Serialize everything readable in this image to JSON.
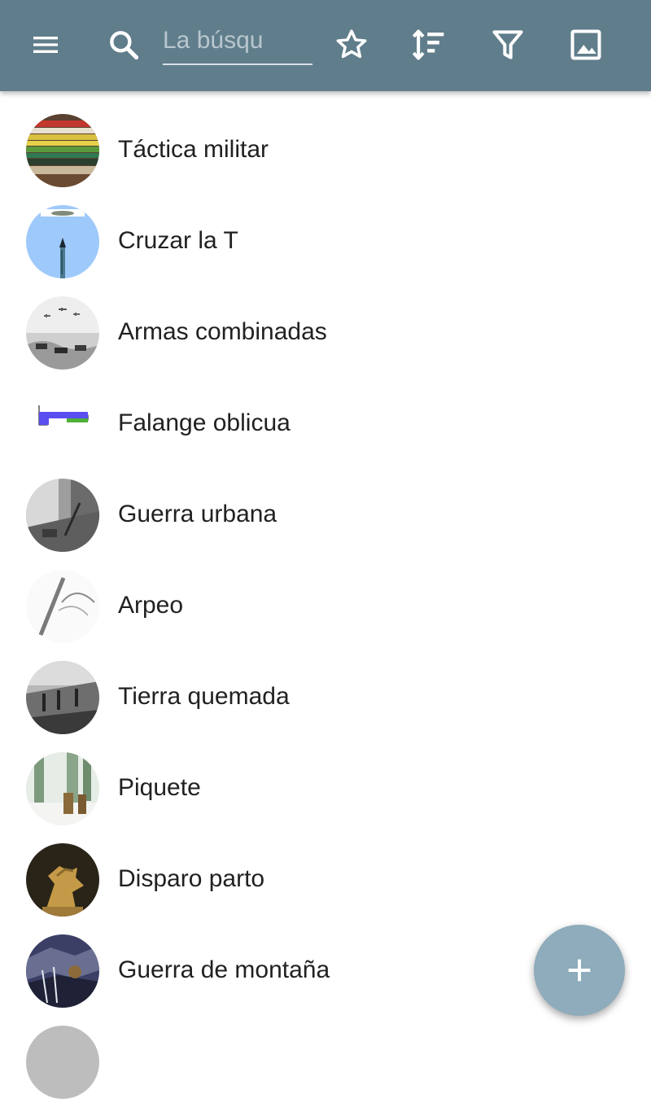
{
  "toolbar": {
    "color": "#607d8b",
    "icons": [
      "menu-icon",
      "search-icon",
      "star-outline-icon",
      "sort-icon",
      "filter-icon",
      "image-icon"
    ],
    "search": {
      "placeholder": "La búsqu",
      "value": ""
    }
  },
  "list": {
    "items": [
      {
        "label": "Táctica militar"
      },
      {
        "label": "Cruzar la T"
      },
      {
        "label": "Armas combinadas"
      },
      {
        "label": "Falange oblicua"
      },
      {
        "label": "Guerra urbana"
      },
      {
        "label": "Arpeo"
      },
      {
        "label": "Tierra quemada"
      },
      {
        "label": "Piquete"
      },
      {
        "label": "Disparo parto"
      },
      {
        "label": "Guerra de montaña"
      }
    ]
  },
  "fab": {
    "icon": "plus-icon",
    "color": "#8eacbb"
  }
}
